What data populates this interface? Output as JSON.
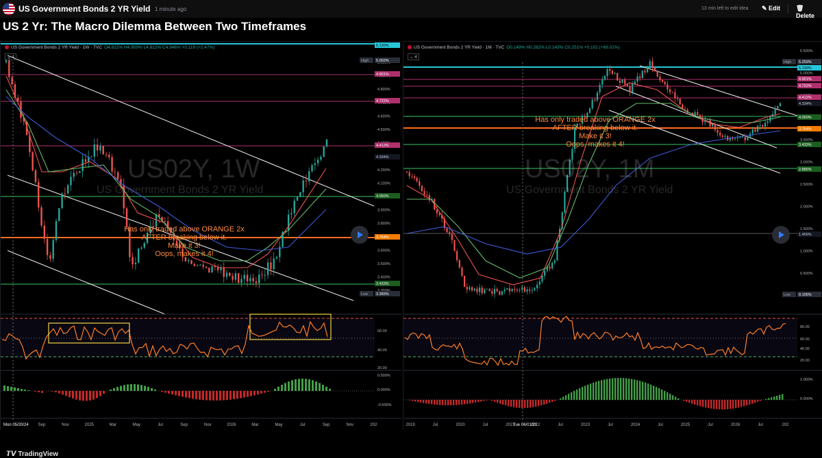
{
  "header": {
    "title": "US Government Bonds 2 YR Yield",
    "time": "1 minute ago",
    "edit_notice": "13 min left to edit idea",
    "edit_label": "Edit",
    "delete_label": "Delete"
  },
  "idea_title": "US 2 Yr: The Macro Dilemma Between Two Timeframes",
  "colors": {
    "orange": "#ff6d1f",
    "green": "#2e9e4f",
    "teal": "#26a69a",
    "red": "#ef5350",
    "blue_line": "#4a6cf7",
    "cyan": "#26c6da"
  },
  "left": {
    "symbol": "US Government Bonds 2 YR Yield · 1W · TVC",
    "ohlc": "O4.822% H4.959% L4.812% C4.946% +0.119 (+2.47%)",
    "indicator_count": "4",
    "watermark_big": "US02Y, 1W",
    "watermark_small": "US Government Bonds 2 YR Yield",
    "annotation": [
      "Has only traded above ORANGE 2x",
      "AFTER breaking below it.",
      "Make it 3!",
      "Oops, makes it 4!"
    ],
    "price_ticks": [
      "5.000%",
      "4.900%",
      "4.800%",
      "4.700%",
      "4.600%",
      "4.500%",
      "4.400%",
      "4.300%",
      "4.200%",
      "4.100%",
      "4.000%",
      "3.900%",
      "3.800%",
      "3.700%",
      "3.600%",
      "3.500%",
      "3.400%",
      "3.300%"
    ],
    "badges": [
      {
        "label": "5.130%",
        "kind": "cyan"
      },
      {
        "label": "High",
        "kind": "tag"
      },
      {
        "label": "5.002%",
        "kind": "dark"
      },
      {
        "label": "4.901%",
        "kind": "pink"
      },
      {
        "label": "4.722%",
        "kind": "pink"
      },
      {
        "label": "4.412%",
        "kind": "pink"
      },
      {
        "label": "4.334%",
        "kind": "plain"
      },
      {
        "label": "4.050%",
        "kind": "green"
      },
      {
        "label": "3.764%",
        "kind": "orange"
      },
      {
        "label": "3.433%",
        "kind": "green"
      },
      {
        "label": "Low",
        "kind": "tag"
      },
      {
        "label": "3.365%",
        "kind": "dark"
      }
    ],
    "rsi_ticks": [
      "60.00",
      "40.00",
      "20.00"
    ],
    "macd_ticks": [
      "0.500%",
      "0.000%",
      "-0.500%"
    ],
    "time_labels": [
      "Sep",
      "Nov",
      "2025",
      "Mar",
      "May",
      "Jul",
      "Sep",
      "Nov",
      "2026",
      "Mar",
      "May",
      "Jul",
      "Sep",
      "Nov",
      "202"
    ],
    "date_chip": "Mon 05/20/24"
  },
  "right": {
    "symbol": "US Government Bonds 2 YR Yield · 1M · TVC",
    "ohlc": "O0.149% H0.282% L0.143% C0.251% +0.102 (+69.01%)",
    "indicator_count": "4",
    "watermark_big": "US02Y, 1M",
    "watermark_small": "US Government Bonds 2 YR Yield",
    "annotation": [
      "Has only traded above ORANGE 2x",
      "AFTER breaking below it.",
      "Make it 3!",
      "Oops, makes it 4!"
    ],
    "price_ticks": [
      "5.500%",
      "5.000%",
      "4.500%",
      "4.000%",
      "3.500%",
      "3.000%",
      "2.500%",
      "2.000%",
      "1.500%",
      "1.000%",
      "0.500%",
      "0.000%"
    ],
    "badges": [
      {
        "label": "High",
        "kind": "tag"
      },
      {
        "label": "5.259%",
        "kind": "dark"
      },
      {
        "label": "5.130%",
        "kind": "cyan"
      },
      {
        "label": "4.901%",
        "kind": "pink"
      },
      {
        "label": "4.722%",
        "kind": "pink"
      },
      {
        "label": "4.412%",
        "kind": "pink"
      },
      {
        "label": "4.334%",
        "kind": "plain"
      },
      {
        "label": "4.050%",
        "kind": "green"
      },
      {
        "label": "3.764%",
        "kind": "orange"
      },
      {
        "label": "3.433%",
        "kind": "green"
      },
      {
        "label": "2.885%",
        "kind": "green"
      },
      {
        "label": "1.456%",
        "kind": "plain"
      },
      {
        "label": "Low",
        "kind": "tag"
      },
      {
        "label": "0.105%",
        "kind": "dark"
      }
    ],
    "rsi_ticks": [
      "80.00",
      "60.00",
      "40.00",
      "20.00"
    ],
    "macd_ticks": [
      "2.000%",
      "0.000%"
    ],
    "time_labels": [
      "2019",
      "Jul",
      "2020",
      "Jul",
      "2021",
      "2022",
      "Jul",
      "2023",
      "Jul",
      "2024",
      "Jul",
      "2025",
      "Jul",
      "2026",
      "Jul",
      "202"
    ],
    "date_chip": "Tue 06/01/21"
  },
  "brand": "TradingView"
}
